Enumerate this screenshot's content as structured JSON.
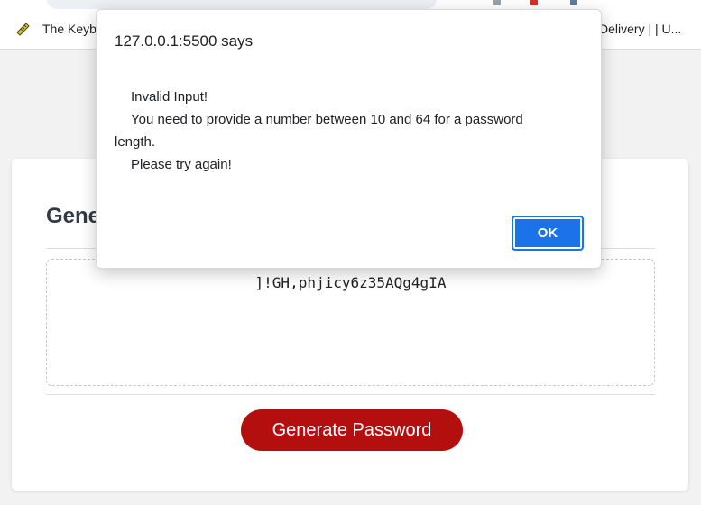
{
  "browser": {
    "bookmarks": [
      {
        "label": "The Keyb",
        "icon": "ruler-icon"
      },
      {
        "label": "Delivery | | U..."
      }
    ]
  },
  "app": {
    "title": "Gene",
    "password": "]!GH,phjicy6z35AQg4gIA",
    "generate_button": "Generate Password",
    "accent": "#b30f0f"
  },
  "dialog": {
    "title": "127.0.0.1:5500 says",
    "message_lines": [
      "Invalid Input!",
      "You need to provide a number between 10 and 64 for a password",
      "length.",
      "Please try again!"
    ],
    "ok_label": "OK",
    "button_color": "#1a73e8"
  }
}
